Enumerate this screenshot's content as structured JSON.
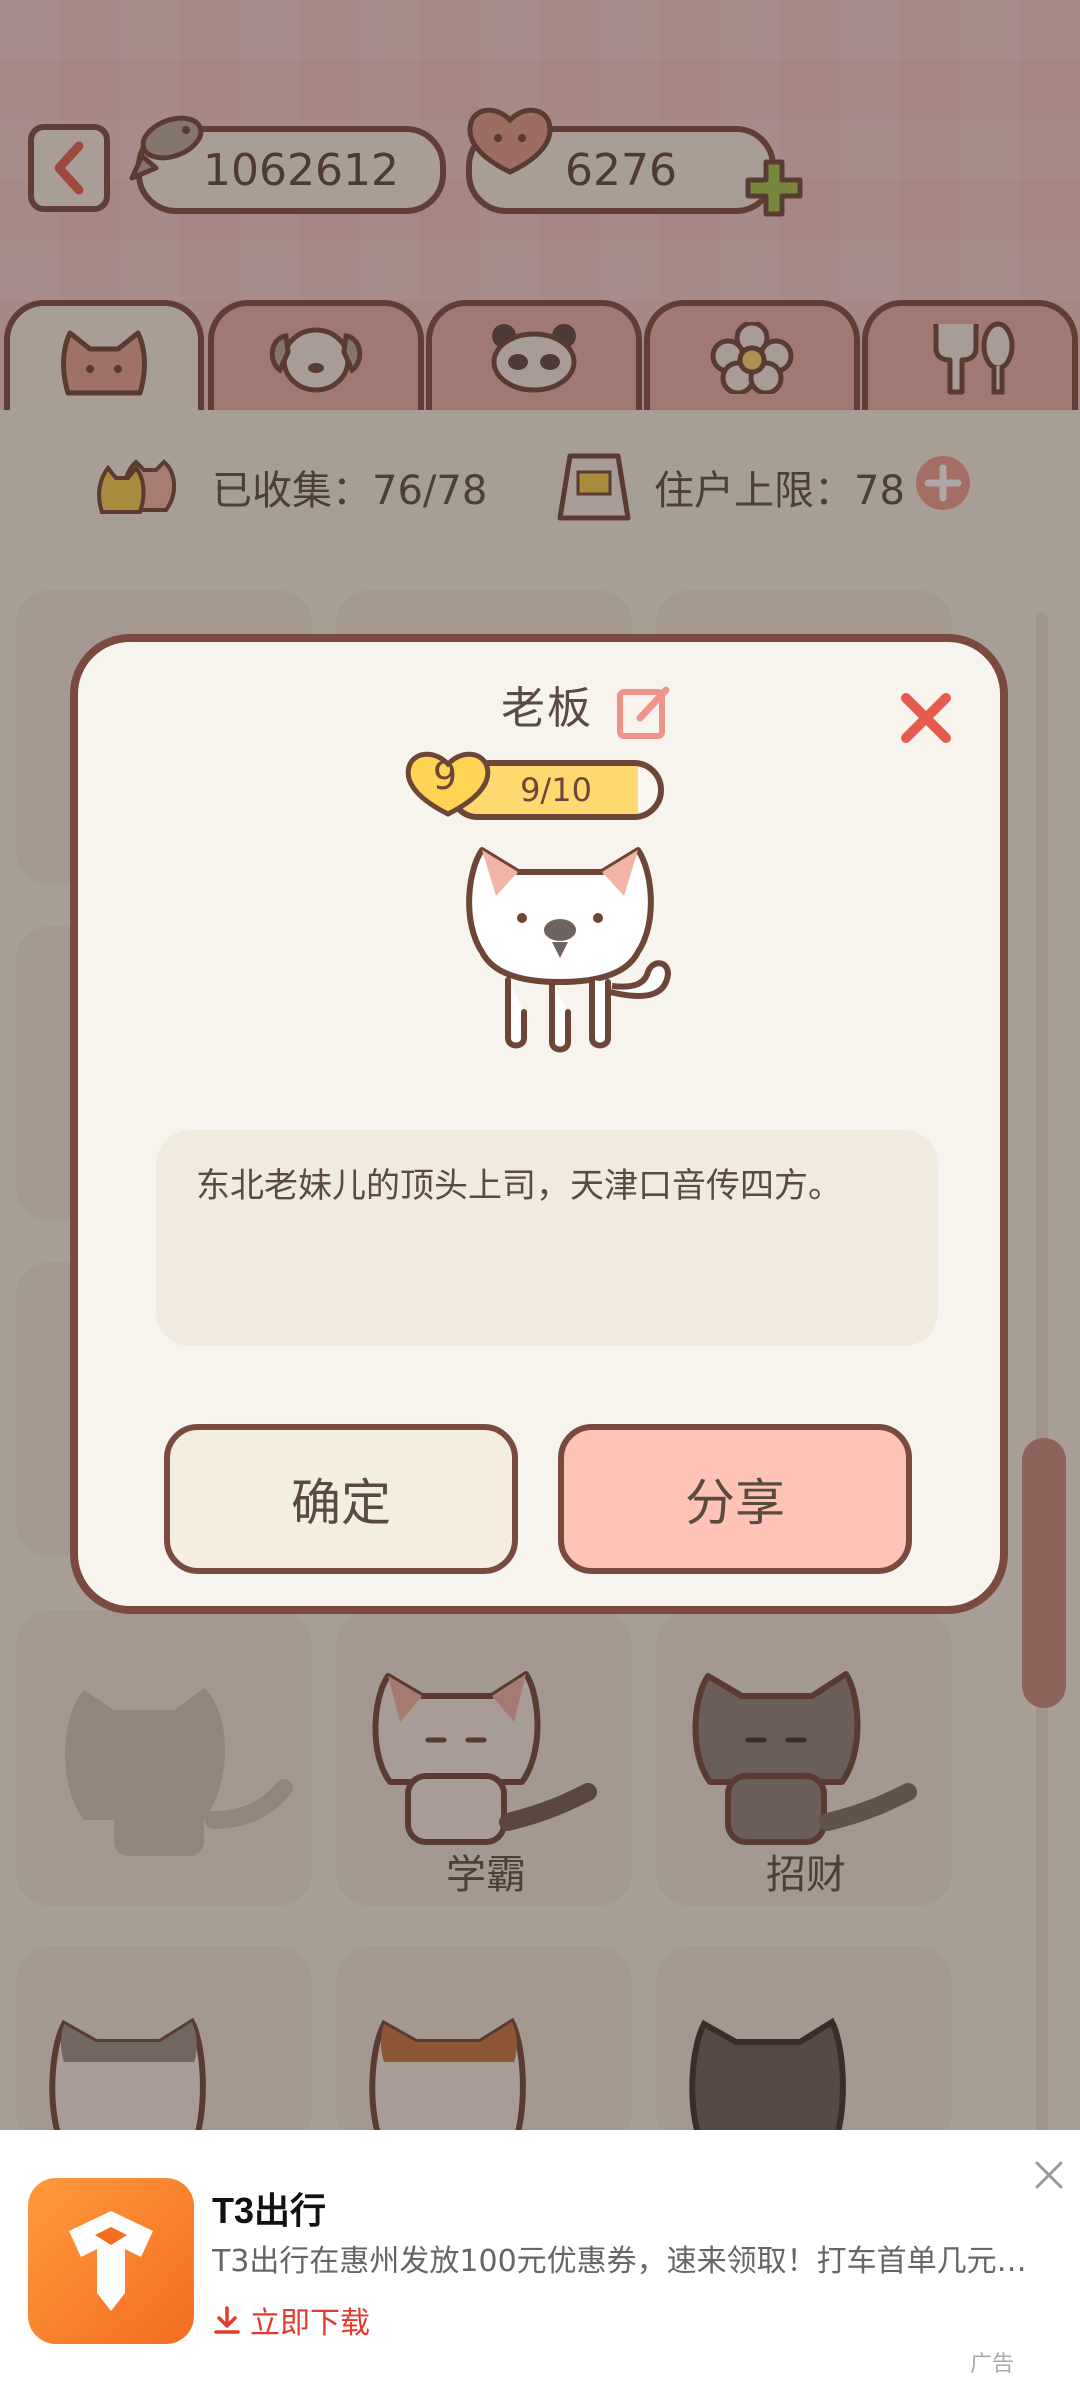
{
  "header": {
    "fish_value": "1062612",
    "heart_value": "6276"
  },
  "tabs": [
    {
      "icon": "cat-face-icon",
      "active": true
    },
    {
      "icon": "dog-face-icon",
      "active": false
    },
    {
      "icon": "panda-face-icon",
      "active": false
    },
    {
      "icon": "flower-icon",
      "active": false
    },
    {
      "icon": "fork-spoon-icon",
      "active": false
    }
  ],
  "stats": {
    "collected": "已收集：76/78",
    "resident_limit": "住户上限：78"
  },
  "cats": [
    {
      "name": "学霸"
    },
    {
      "name": "招财"
    }
  ],
  "modal": {
    "title": "老板",
    "level": "9",
    "progress_text": "9/10",
    "progress_fraction": 0.9,
    "description": "东北老妹儿的顶头上司，天津口音传四方。",
    "confirm_label": "确定",
    "share_label": "分享"
  },
  "ad": {
    "title": "T3出行",
    "description": "T3出行在惠州发放100元优惠券，速来领取！打车首单几元…",
    "download_label": "立即下载",
    "ad_tag": "广告"
  },
  "colors": {
    "outline": "#7a4a3e",
    "accent_red": "#e86a5e",
    "progress_yellow": "#ffd970",
    "share_bg": "#ffc3b7",
    "ad_orange": "#f36d21"
  }
}
